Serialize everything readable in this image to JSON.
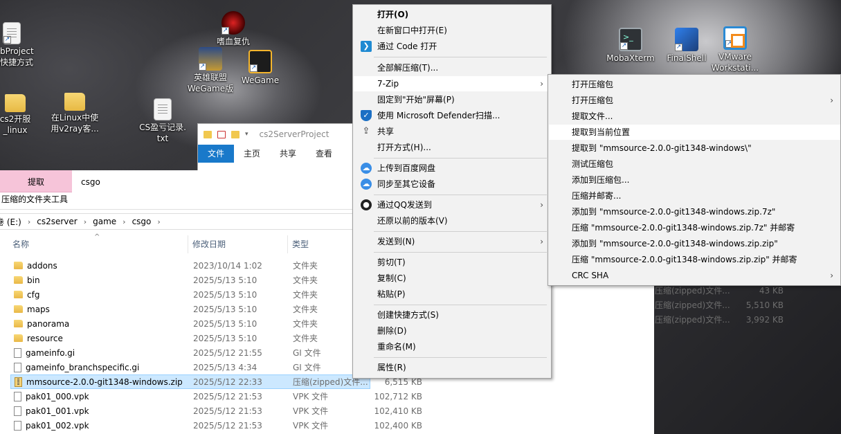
{
  "desktop": {
    "icons": [
      {
        "label": "bProject\n快捷方式",
        "icon": "shortcut-folder-icon"
      },
      {
        "label": "嗜血复仇",
        "icon": "game-icon"
      },
      {
        "label": "英雄联盟\nWeGame版",
        "icon": "league-of-legends-icon"
      },
      {
        "label": "WeGame",
        "icon": "wegame-icon"
      },
      {
        "label": "cs2开服\n_linux",
        "icon": "folder-icon"
      },
      {
        "label": "在Linux中使\n用v2ray客...",
        "icon": "folder-icon"
      },
      {
        "label": "CS盈亏记录.\ntxt",
        "icon": "text-file-icon"
      },
      {
        "label": "MobaXterm",
        "icon": "mobaxterm-icon"
      },
      {
        "label": "FinalShell",
        "icon": "finalshell-icon"
      },
      {
        "label": "VMware\nWorkstati...",
        "icon": "vmware-icon"
      }
    ]
  },
  "back_window": {
    "title": "cs2ServerProject",
    "tabs": [
      "文件",
      "主页",
      "共享",
      "查看"
    ]
  },
  "explorer": {
    "context_tab": "提取",
    "context_sub": "压缩的文件夹工具",
    "tab_title": "csgo",
    "breadcrumb": [
      "卷 (E:)",
      "cs2server",
      "game",
      "csgo"
    ],
    "columns": {
      "name": "名称",
      "date": "修改日期",
      "type": "类型"
    },
    "files": [
      {
        "name": "addons",
        "date": "2023/10/14 1:02",
        "type": "文件夹",
        "size": "",
        "kind": "folder"
      },
      {
        "name": "bin",
        "date": "2025/5/13 5:10",
        "type": "文件夹",
        "size": "",
        "kind": "folder"
      },
      {
        "name": "cfg",
        "date": "2025/5/13 5:10",
        "type": "文件夹",
        "size": "",
        "kind": "folder"
      },
      {
        "name": "maps",
        "date": "2025/5/13 5:10",
        "type": "文件夹",
        "size": "",
        "kind": "folder"
      },
      {
        "name": "panorama",
        "date": "2025/5/13 5:10",
        "type": "文件夹",
        "size": "",
        "kind": "folder"
      },
      {
        "name": "resource",
        "date": "2025/5/13 5:10",
        "type": "文件夹",
        "size": "",
        "kind": "folder"
      },
      {
        "name": "gameinfo.gi",
        "date": "2025/5/12 21:55",
        "type": "GI 文件",
        "size": "",
        "kind": "file"
      },
      {
        "name": "gameinfo_branchspecific.gi",
        "date": "2025/5/13 4:34",
        "type": "GI 文件",
        "size": "",
        "kind": "file"
      },
      {
        "name": "mmsource-2.0.0-git1348-windows.zip",
        "date": "2025/5/12 22:33",
        "type": "压缩(zipped)文件...",
        "size": "6,515 KB",
        "kind": "zip",
        "selected": true
      },
      {
        "name": "pak01_000.vpk",
        "date": "2025/5/12 21:53",
        "type": "VPK 文件",
        "size": "102,712 KB",
        "kind": "file"
      },
      {
        "name": "pak01_001.vpk",
        "date": "2025/5/12 21:53",
        "type": "VPK 文件",
        "size": "102,410 KB",
        "kind": "file"
      },
      {
        "name": "pak01_002.vpk",
        "date": "2025/5/12 21:53",
        "type": "VPK 文件",
        "size": "102,400 KB",
        "kind": "file"
      }
    ],
    "right_pane_rows": [
      {
        "type": "压缩(zipped)文件...",
        "size": "43 KB"
      },
      {
        "type": "压缩(zipped)文件...",
        "size": "5,510 KB"
      },
      {
        "type": "压缩(zipped)文件...",
        "size": "3,992 KB"
      }
    ]
  },
  "context_menu": {
    "items": [
      {
        "label": "打开(O)",
        "bold": true
      },
      {
        "label": "在新窗口中打开(E)"
      },
      {
        "label": "通过 Code 打开",
        "icon": "vscode-icon"
      },
      {
        "sep": true
      },
      {
        "label": "全部解压缩(T)..."
      },
      {
        "label": "7-Zip",
        "submenu": true,
        "hover": true
      },
      {
        "label": "固定到\"开始\"屏幕(P)"
      },
      {
        "label": "使用 Microsoft Defender扫描...",
        "icon": "defender-shield-icon"
      },
      {
        "label": "共享",
        "icon": "share-icon"
      },
      {
        "label": "打开方式(H)..."
      },
      {
        "sep": true
      },
      {
        "label": "上传到百度网盘",
        "icon": "baidu-netdisk-icon"
      },
      {
        "label": "同步至其它设备",
        "icon": "baidu-sync-icon"
      },
      {
        "sep": true
      },
      {
        "label": "通过QQ发送到",
        "icon": "qq-icon",
        "submenu": true
      },
      {
        "label": "还原以前的版本(V)"
      },
      {
        "sep": true
      },
      {
        "label": "发送到(N)",
        "submenu": true
      },
      {
        "sep": true
      },
      {
        "label": "剪切(T)"
      },
      {
        "label": "复制(C)"
      },
      {
        "label": "粘贴(P)"
      },
      {
        "sep": true
      },
      {
        "label": "创建快捷方式(S)"
      },
      {
        "label": "删除(D)"
      },
      {
        "label": "重命名(M)"
      },
      {
        "sep": true
      },
      {
        "label": "属性(R)"
      }
    ]
  },
  "sevenzip_submenu": {
    "items": [
      {
        "label": "打开压缩包"
      },
      {
        "label": "打开压缩包",
        "submenu": true
      },
      {
        "label": "提取文件..."
      },
      {
        "label": "提取到当前位置",
        "hover": true
      },
      {
        "label": "提取到 \"mmsource-2.0.0-git1348-windows\\\""
      },
      {
        "label": "测试压缩包"
      },
      {
        "label": "添加到压缩包..."
      },
      {
        "label": "压缩并邮寄..."
      },
      {
        "label": "添加到 \"mmsource-2.0.0-git1348-windows.zip.7z\""
      },
      {
        "label": "压缩 \"mmsource-2.0.0-git1348-windows.zip.7z\" 并邮寄"
      },
      {
        "label": "添加到 \"mmsource-2.0.0-git1348-windows.zip.zip\""
      },
      {
        "label": "压缩 \"mmsource-2.0.0-git1348-windows.zip.zip\" 并邮寄"
      },
      {
        "label": "CRC SHA",
        "submenu": true
      }
    ]
  },
  "colors": {
    "ribbon_file_tab": "#1979ca",
    "context_tab": "#f6c4d9",
    "selection": "#cce8ff",
    "menu_bg": "#f2f2f2"
  }
}
